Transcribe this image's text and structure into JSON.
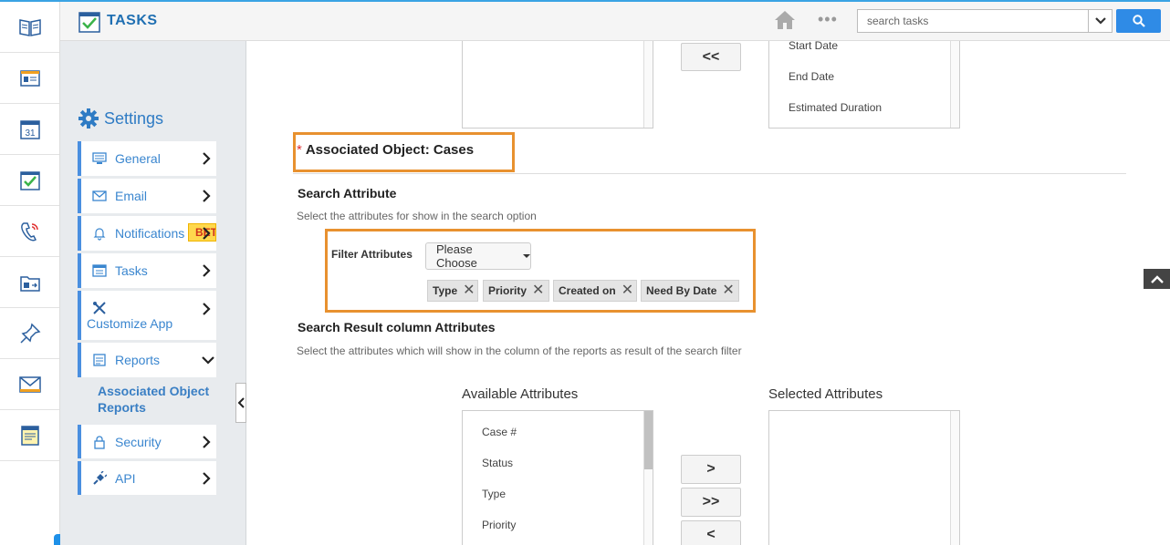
{
  "header": {
    "app_title": "TASKS",
    "search_placeholder": "search tasks",
    "more_label": "•••"
  },
  "rail": {
    "icons": [
      "books-icon",
      "contacts-card-icon",
      "calendar-icon",
      "tasks-check-icon",
      "phone-icon",
      "contacts-folder-icon",
      "pin-icon",
      "mail-icon",
      "notes-icon"
    ],
    "calendar_day": "31"
  },
  "settings": {
    "title": "Settings",
    "items": [
      {
        "label": "General",
        "icon": "monitor-icon"
      },
      {
        "label": "Email",
        "icon": "envelope-icon"
      },
      {
        "label": "Notifications",
        "icon": "bell-icon",
        "badge": "BETA"
      },
      {
        "label": "Tasks",
        "icon": "tasks-list-icon"
      },
      {
        "label": "Customize App",
        "icon": "tools-icon"
      },
      {
        "label": "Reports",
        "icon": "reports-icon"
      },
      {
        "label": "Security",
        "icon": "lock-icon"
      },
      {
        "label": "API",
        "icon": "plug-icon"
      }
    ],
    "reports_sub_item": "Associated Object Reports"
  },
  "top_lists": {
    "right_items": [
      "Start Date",
      "End Date",
      "Estimated Duration"
    ],
    "move_all_left_label": "<<"
  },
  "associated_object": {
    "required_mark": "*",
    "title": "Associated Object: Cases"
  },
  "search_attribute": {
    "title": "Search Attribute",
    "description": "Select the attributes for show in the search option",
    "filter_label": "Filter Attributes",
    "dropdown_value": "Please Choose",
    "selected_tags": [
      "Type",
      "Priority",
      "Created on",
      "Need By Date"
    ],
    "remove_symbol": "✕"
  },
  "search_result": {
    "title": "Search Result column Attributes",
    "description": "Select the attributes which will show in the column of the reports as result of the search filter",
    "available_title": "Available Attributes",
    "selected_title": "Selected Attributes",
    "available_items": [
      "Case #",
      "Status",
      "Type",
      "Priority"
    ],
    "buttons": [
      ">",
      ">>",
      "<"
    ]
  },
  "colors": {
    "accent": "#3a86cf",
    "highlight_border": "#e8912f",
    "search_button": "#2f8be6"
  }
}
